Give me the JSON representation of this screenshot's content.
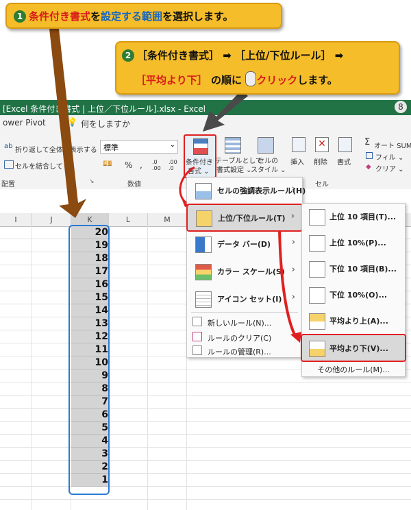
{
  "callout1": {
    "num": "1",
    "part1": "条件付き書式",
    "part2": "を",
    "part3": "設定する範囲",
    "part4": "を選択します。"
  },
  "callout2": {
    "num": "2",
    "line1": "［条件付き書式］ ➡ ［上位/下位ルール］ ➡",
    "line2a": "［平均より下］",
    "line2b": "の順に",
    "line2c": "クリック",
    "line2d": "します。"
  },
  "titlebar": {
    "title": "[Excel 条件付き書式 | 上位／下位ルール].xlsx  -  Excel",
    "avatar": "8"
  },
  "menubar": {
    "item1": "ower Pivot",
    "search": "何をしますか"
  },
  "ribbon": {
    "wrap": "折り返して全体を表示する",
    "merge": "セルを結合して",
    "format_value": "標準",
    "percent": "%",
    "comma": ",",
    "cf_label1": "条件付き",
    "cf_label2": "書式 ⌄",
    "tbl_label1": "テーブルとして",
    "tbl_label2": "書式設定 ⌄",
    "style_label1": "セルの",
    "style_label2": "スタイル ⌄",
    "insert": "挿入",
    "delete": "削除",
    "format": "書式",
    "autosum": "オート SUM",
    "fill": "フィル ⌄",
    "clear": "クリア ⌄",
    "grp_align": "配置",
    "grp_number": "数値",
    "grp_cell": "セル"
  },
  "columns": [
    "I",
    "J",
    "K",
    "L",
    "M"
  ],
  "cells": [
    "20",
    "19",
    "18",
    "17",
    "16",
    "15",
    "14",
    "13",
    "12",
    "11",
    "10",
    "9",
    "8",
    "7",
    "6",
    "5",
    "4",
    "3",
    "2",
    "1"
  ],
  "menu1": {
    "items": [
      "セルの強調表示ルール(H)",
      "上位/下位ルール(T)",
      "データ バー(D)",
      "カラー スケール(S)",
      "アイコン セット(I)"
    ],
    "small": [
      "新しいルール(N)...",
      "ルールのクリア(C)",
      "ルールの管理(R)..."
    ]
  },
  "menu2": {
    "items": [
      "上位 10 項目(T)...",
      "上位 10%(P)...",
      "下位 10 項目(B)...",
      "下位 10%(O)...",
      "平均より上(A)...",
      "平均より下(V)..."
    ],
    "other": "その他のルール(M)..."
  }
}
